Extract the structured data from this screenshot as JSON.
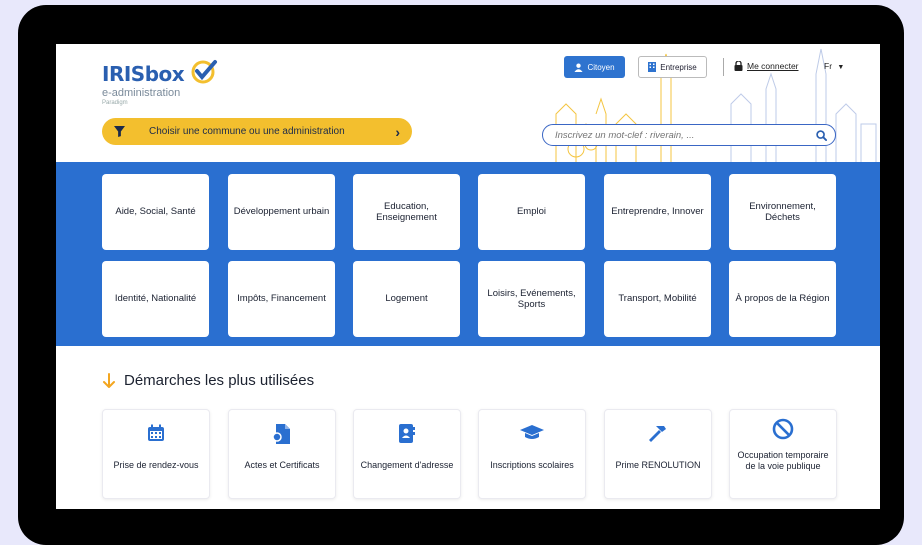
{
  "logo": {
    "name": "IRISbox",
    "subtitle": "e-administration",
    "caption": "Paradigm"
  },
  "header": {
    "citoyen_label": "Citoyen",
    "entreprise_label": "Entreprise",
    "login_label": "Me connecter",
    "language": "Fr"
  },
  "commune_selector": {
    "label": "Choisir une commune ou une administration"
  },
  "search": {
    "placeholder": "Inscrivez un mot-clef : riverain, ..."
  },
  "categories": [
    {
      "label": "Aide, Social, Santé"
    },
    {
      "label": "Développement urbain"
    },
    {
      "label": "Education, Enseignement"
    },
    {
      "label": "Emploi"
    },
    {
      "label": "Entreprendre, Innover"
    },
    {
      "label": "Environnement, Déchets"
    },
    {
      "label": "Identité, Nationalité"
    },
    {
      "label": "Impôts, Financement"
    },
    {
      "label": "Logement"
    },
    {
      "label": "Loisirs, Evénements, Sports"
    },
    {
      "label": "Transport, Mobilité"
    },
    {
      "label": "À propos de la Région"
    }
  ],
  "section": {
    "title": "Démarches les plus utilisées"
  },
  "procedures": [
    {
      "label": "Prise de rendez-vous",
      "icon": "calendar-icon"
    },
    {
      "label": "Actes et Certificats",
      "icon": "certificate-icon"
    },
    {
      "label": "Changement d'adresse",
      "icon": "address-book-icon"
    },
    {
      "label": "Inscriptions scolaires",
      "icon": "graduation-cap-icon"
    },
    {
      "label": "Prime RENOLUTION",
      "icon": "hammer-icon"
    },
    {
      "label": "Occupation temporaire de la voie publique",
      "icon": "prohibited-icon"
    }
  ],
  "colors": {
    "brand_blue": "#2a6fd0",
    "accent_yellow": "#f3bf2e",
    "page_bg": "#e8e8fb"
  }
}
